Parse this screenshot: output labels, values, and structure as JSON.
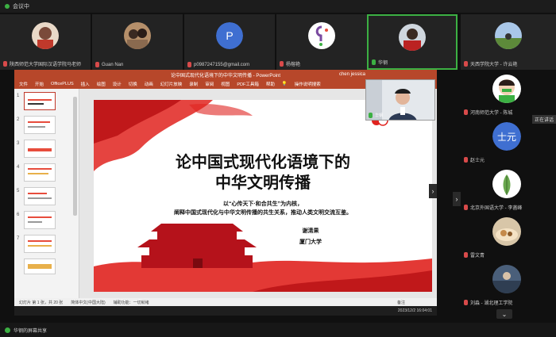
{
  "window": {
    "title": "会议中"
  },
  "participants": [
    {
      "name": "陕西师范大学国际汉语学院马老师",
      "mic": "off"
    },
    {
      "name": "Guan Nan",
      "mic": "off"
    },
    {
      "name": "p0987247155@gmail.com",
      "mic": "off",
      "initial": "P"
    },
    {
      "name": "杨榕艳",
      "mic": "off"
    },
    {
      "name": "华钢",
      "mic": "on",
      "active": true
    },
    {
      "name": "天西学院大学 - 许云艳",
      "mic": "off"
    }
  ],
  "right_participants": [
    {
      "name": "河南师范大学 - 陈城",
      "mic": "off"
    },
    {
      "name": "赵士元",
      "mic": "off",
      "initial": "士元"
    },
    {
      "name": "北京外国语大学 - 李菡峰",
      "mic": "off"
    },
    {
      "name": "雷文青",
      "mic": "off"
    },
    {
      "name": "刘淼 - 湖北理工学院",
      "mic": "off"
    }
  ],
  "tooltip": "正在讲话",
  "powerpoint": {
    "title": "论中国式现代化语境下的中华文明传播 - PowerPoint",
    "user": "chen jessica",
    "ribbon_tabs": [
      "文件",
      "开始",
      "OfficePLUS",
      "插入",
      "绘图",
      "设计",
      "切换",
      "动画",
      "幻灯片放映",
      "录制",
      "审阅",
      "视图",
      "PDF工具箱",
      "帮助",
      "操作说明搜索"
    ],
    "slide_count": 7,
    "status_slide": "幻灯片 第 1 张，共 20 张",
    "status_lang": "简体中文(中国大陆)",
    "status_access": "辅助功能：一切就绪",
    "status_right": "备注",
    "taskbar_time": "2023/12/2 16:04:01"
  },
  "slide": {
    "title_line1": "论中国式现代化语境下的",
    "title_line2": "中华文明传播",
    "subtitle1": "以“心传天下·和合共生”为内核，",
    "subtitle2": "阐释中国式现代化与中华文明传播的共生关系，推动人类文明交流互鉴。",
    "author": "谢清果",
    "affiliation": "厦门大学"
  },
  "presenter": {
    "name": "华钢"
  },
  "bottom": {
    "share_label": "华钢的屏幕共享"
  },
  "colors": {
    "accent": "#3cb043",
    "pp_red": "#b7472a",
    "slide_red": "#e0231f"
  }
}
